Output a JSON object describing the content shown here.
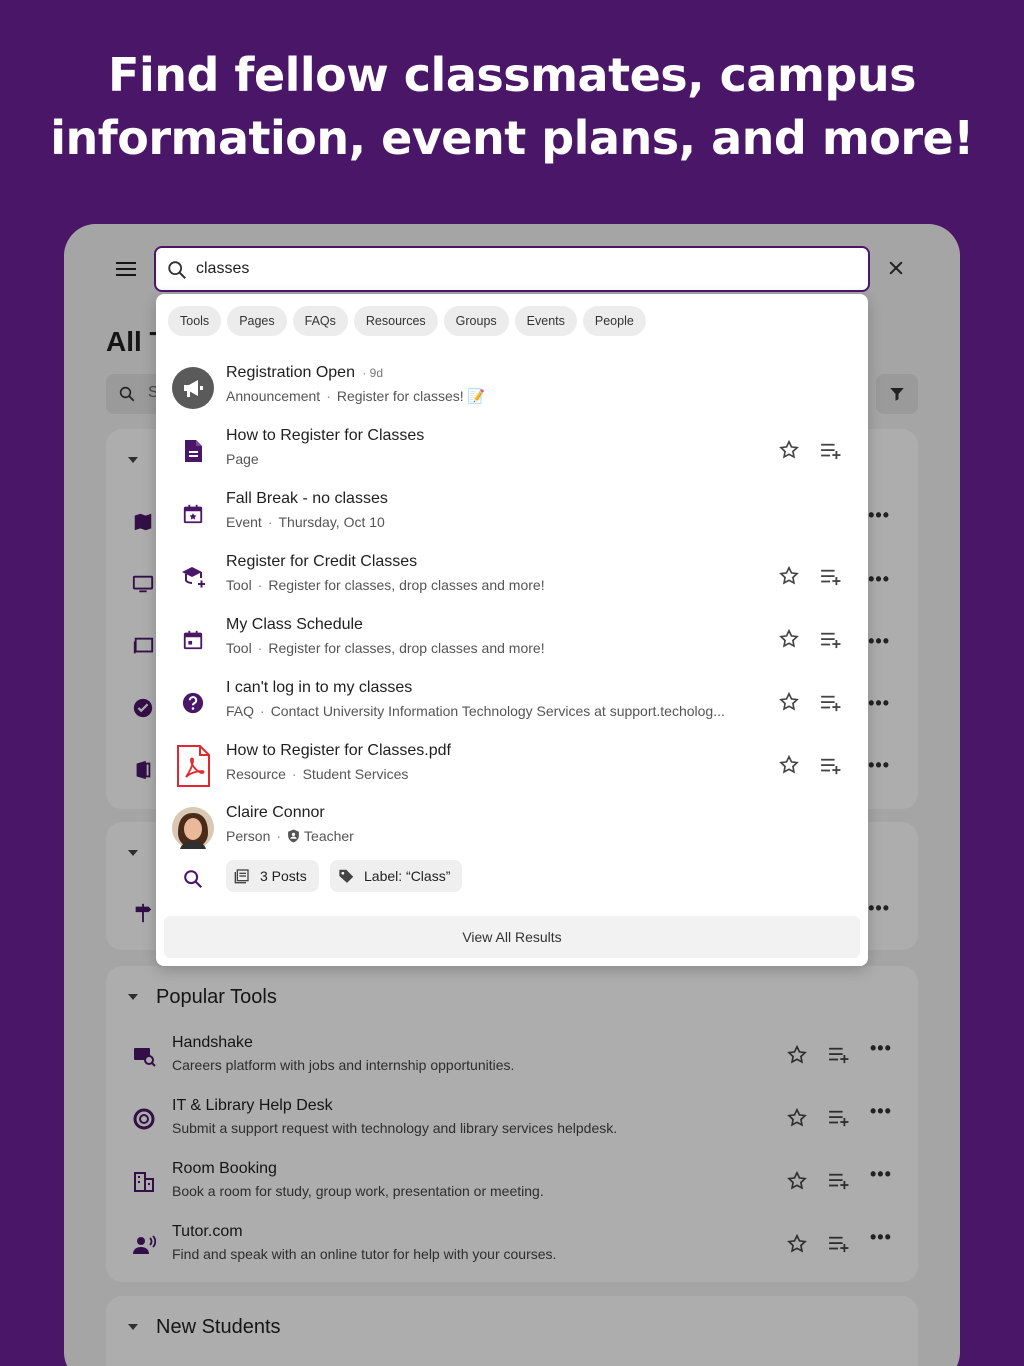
{
  "headline": {
    "line1": "Find fellow classmates, campus",
    "line2": "information, event plans, and more!"
  },
  "background": {
    "title": "All T",
    "search_placeholder": "S",
    "section_popular": "Popular Tools",
    "section_new": "New Students",
    "popular_tools": [
      {
        "name": "Handshake",
        "desc": "Careers platform with jobs and internship opportunities.",
        "icon": "handshake-icon"
      },
      {
        "name": "IT & Library Help Desk",
        "desc": "Submit a support request with technology and library services helpdesk.",
        "icon": "lifebuoy-icon"
      },
      {
        "name": "Room Booking",
        "desc": "Book a room for study, group work, presentation or meeting.",
        "icon": "building-icon"
      },
      {
        "name": "Tutor.com",
        "desc": "Find and speak with an online tutor for help with your courses.",
        "icon": "speaking-person-icon"
      }
    ]
  },
  "search": {
    "query": "classes",
    "filters": [
      "Tools",
      "Pages",
      "FAQs",
      "Resources",
      "Groups",
      "Events",
      "People"
    ],
    "results": [
      {
        "title": "Registration Open",
        "age": "9d",
        "type": "Announcement",
        "detail": "Register for classes! 📝",
        "icon": "megaphone-icon",
        "actions": false
      },
      {
        "title": "How to Register for Classes",
        "type": "Page",
        "detail": "",
        "icon": "page-icon",
        "actions": true
      },
      {
        "title": "Fall Break - no classes",
        "type": "Event",
        "detail": "Thursday, Oct 10",
        "icon": "event-icon",
        "actions": false
      },
      {
        "title": "Register for Credit Classes",
        "type": "Tool",
        "detail": "Register for classes, drop classes and more!",
        "icon": "graduation-cap-icon",
        "actions": true
      },
      {
        "title": "My Class Schedule",
        "type": "Tool",
        "detail": "Register for classes, drop classes and more!",
        "icon": "calendar-icon",
        "actions": true
      },
      {
        "title": "I can't log in to my classes",
        "type": "FAQ",
        "detail": "Contact University Information Technology Services at support.techolog...",
        "icon": "question-icon",
        "actions": true
      },
      {
        "title": "How to Register for Classes.pdf",
        "type": "Resource",
        "detail": "Student Services",
        "icon": "pdf-icon",
        "actions": true
      },
      {
        "title": "Claire Connor",
        "type": "Person",
        "detail": "Teacher",
        "icon": "avatar",
        "actions": false
      }
    ],
    "posts_pill": "3 Posts",
    "label_pill": "Label: “Class”",
    "view_all": "View All Results"
  },
  "colors": {
    "brand": "#4a1768",
    "pdf_red": "#e0282e"
  }
}
